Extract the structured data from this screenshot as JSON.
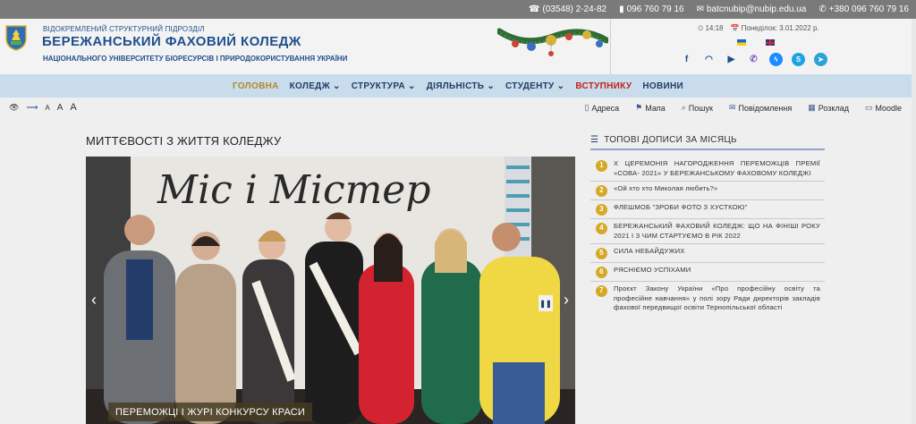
{
  "topbar": {
    "items": [
      {
        "icon": "phone-icon",
        "glyph": "☎",
        "text": "(03548) 2-24-82"
      },
      {
        "icon": "mobile-icon",
        "glyph": "▮",
        "text": "096 760 79 16"
      },
      {
        "icon": "mail-icon",
        "glyph": "✉",
        "text": "batcnubip@nubip.edu.ua"
      },
      {
        "icon": "viber-icon",
        "glyph": "✆",
        "text": "+380 096 760 79 16"
      }
    ]
  },
  "header": {
    "subtitle1": "ВІДОКРЕМЛЕНИЙ СТРУКТУРНИЙ ПІДРОЗДІЛ",
    "college_name": "БЕРЕЖАНСЬКИЙ ФАХОВИЙ КОЛЕДЖ",
    "subtitle2": "НАЦІОНАЛЬНОГО УНІВЕРСИТЕТУ БІОРЕСУРСІВ І ПРИРОДОКОРИСТУВАННЯ УКРАЇНИ",
    "time": "⏲ 14:18",
    "date": "📅 Понеділок: 3.01.2022 р.",
    "socials": [
      {
        "name": "facebook-icon",
        "glyph": "f",
        "color": "#1f4e8c",
        "round": false
      },
      {
        "name": "rss-icon",
        "glyph": "◠",
        "color": "#1f4e8c",
        "round": false
      },
      {
        "name": "youtube-icon",
        "glyph": "▶",
        "color": "#1f4e8c",
        "round": false
      },
      {
        "name": "viber-icon",
        "glyph": "✆",
        "color": "#7d55c7",
        "round": false
      },
      {
        "name": "messenger-icon",
        "glyph": "ϟ",
        "color": "#1a8cff",
        "round": true
      },
      {
        "name": "skype-icon",
        "glyph": "S",
        "color": "#1ca3e3",
        "round": true
      },
      {
        "name": "telegram-icon",
        "glyph": "➤",
        "color": "#2aa3d9",
        "round": true
      }
    ]
  },
  "nav": {
    "items": [
      {
        "label": "ГОЛОВНА",
        "style": "active"
      },
      {
        "label": "КОЛЕДЖ ⌄",
        "style": ""
      },
      {
        "label": "СТРУКТУРА ⌄",
        "style": ""
      },
      {
        "label": "ДІЯЛЬНІСТЬ ⌄",
        "style": ""
      },
      {
        "label": "СТУДЕНТУ ⌄",
        "style": ""
      },
      {
        "label": "ВСТУПНИКУ",
        "style": "red"
      },
      {
        "label": "НОВИНИ",
        "style": ""
      }
    ]
  },
  "access": {
    "eye_glyph": "👁",
    "arrow_glyph": "⟶",
    "sizes": [
      "A",
      "A",
      "A"
    ]
  },
  "quicklinks": [
    {
      "icon": "address-icon",
      "glyph": "▯",
      "label": "Адреса"
    },
    {
      "icon": "map-icon",
      "glyph": "⚑",
      "label": "Мапа"
    },
    {
      "icon": "search-icon",
      "glyph": "⌕",
      "label": "Пошук"
    },
    {
      "icon": "message-icon",
      "glyph": "✉",
      "label": "Повідомлення"
    },
    {
      "icon": "schedule-icon",
      "glyph": "▦",
      "label": "Розклад"
    },
    {
      "icon": "moodle-icon",
      "glyph": "▭",
      "label": "Moodle"
    }
  ],
  "main": {
    "section_title": "МИТТЄВОСТІ З ЖИТТЯ КОЛЕДЖУ",
    "slide_caption": "ПЕРЕМОЖЦІ І ЖУРІ КОНКУРСУ КРАСИ",
    "slide_sign": "Міс і Містер",
    "prev_glyph": "‹",
    "next_glyph": "›",
    "pause_glyph": "❚❚"
  },
  "sidebar": {
    "title": "ТОПОВІ ДОПИСИ ЗА МІСЯЦЬ",
    "title_glyph": "☰",
    "items": [
      {
        "num": "1",
        "text": "Х ЦЕРЕМОНІЯ НАГОРОДЖЕННЯ ПЕРЕМОЖЦІВ ПРЕМІЇ «СОВА- 2021» У БЕРЕЖАНСЬКОМУ ФАХОВОМУ КОЛЕДЖІ"
      },
      {
        "num": "2",
        "text": "«Ой хто хто Миколая любить?»"
      },
      {
        "num": "3",
        "text": "ФЛЕШМОБ \"ЗРОБИ ФОТО З ХУСТКОЮ\""
      },
      {
        "num": "4",
        "text": "БЕРЕЖАНСЬКИЙ ФАХОВИЙ КОЛЕДЖ: ЩО НА ФІНІШІ РОКУ 2021 І З ЧИМ СТАРТУЄМО В РІК 2022"
      },
      {
        "num": "5",
        "text": "СИЛА НЕБАЙДУЖИХ"
      },
      {
        "num": "6",
        "text": "РЯСНІЄМО УСПІХАМИ"
      },
      {
        "num": "7",
        "text": "Проєкт Закону України «Про професійну освіту та професійне навчання» у полі зору Ради директорів закладів фахової передвищої освіти Тернопільської області"
      }
    ]
  },
  "colors": {
    "brand_blue": "#1f4e8c",
    "nav_bg": "#c9dcec",
    "gold": "#d5a926",
    "admission_red": "#c4201a"
  }
}
